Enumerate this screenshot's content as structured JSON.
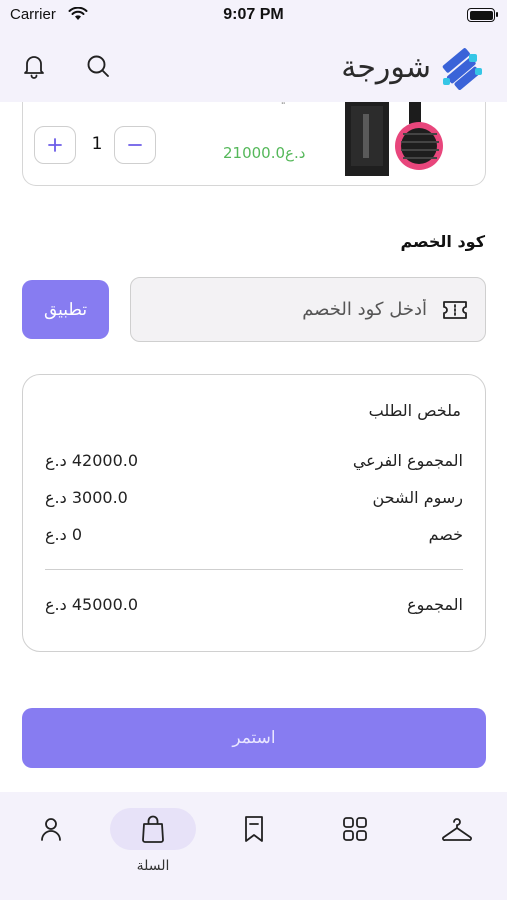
{
  "status_bar": {
    "carrier": "Carrier",
    "time": "9:07 PM"
  },
  "header": {
    "brand_name": "شورجة",
    "icons": [
      "notification-bell-icon",
      "search-icon",
      "brand-logo-icon"
    ]
  },
  "cart_item": {
    "name_fragment": "ـي",
    "quantity": "1",
    "price": "د.ع21000.0",
    "increment_symbol": "+",
    "decrement_symbol": "−"
  },
  "discount": {
    "section_title": "كود الخصم",
    "placeholder": "أدخل كود الخصم",
    "apply_label": "تطبيق"
  },
  "summary": {
    "title": "ملخص الطلب",
    "rows": [
      {
        "label": "المجموع الفرعي",
        "value": "42000.0 د.ع"
      },
      {
        "label": "رسوم الشحن",
        "value": "3000.0 د.ع"
      },
      {
        "label": "خصم",
        "value": "0 د.ع"
      }
    ],
    "total_label": "المجموع",
    "total_value": "45000.0 د.ع"
  },
  "continue_label": "استمر",
  "tabs": [
    {
      "icon": "profile-icon",
      "label": ""
    },
    {
      "icon": "shopping-bag-icon",
      "label": "السلة",
      "active": true
    },
    {
      "icon": "bookmark-icon",
      "label": ""
    },
    {
      "icon": "categories-grid-icon",
      "label": ""
    },
    {
      "icon": "hanger-icon",
      "label": ""
    }
  ],
  "colors": {
    "accent": "#877cf1",
    "price_green": "#55b85a",
    "header_bg": "#f4f2fb",
    "brand_blue": "#3a63d8",
    "brand_cyan": "#35c6e6"
  }
}
